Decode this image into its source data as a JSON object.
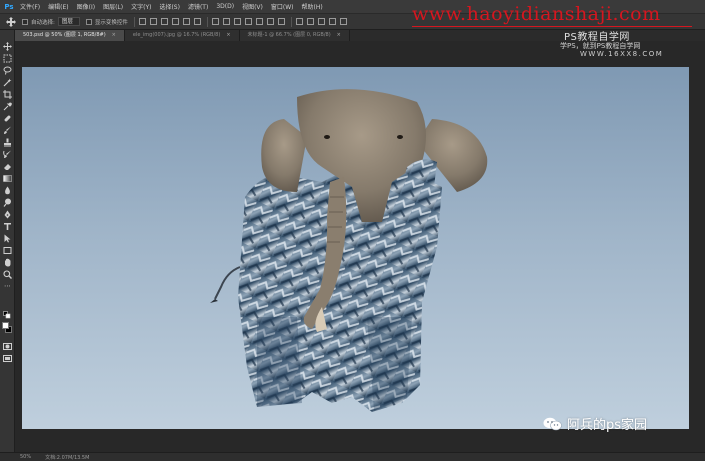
{
  "app": {
    "logo": "Ps"
  },
  "menu": [
    "文件(F)",
    "编辑(E)",
    "图像(I)",
    "图层(L)",
    "文字(Y)",
    "选择(S)",
    "滤镜(T)",
    "3D(D)",
    "视图(V)",
    "窗口(W)",
    "帮助(H)"
  ],
  "options": {
    "auto_select_label": "自动选择:",
    "auto_select_value": "图层",
    "show_transform_label": "显示变换控件"
  },
  "tabs": [
    {
      "label": "503.psd @ 50% (图层 1, RGB/8#)",
      "active": true
    },
    {
      "label": "ele_img(007).jpg @ 16.7% (RGB/8)",
      "active": false
    },
    {
      "label": "未标题-1 @ 66.7% (图层 0, RGB/8)",
      "active": false
    }
  ],
  "status": {
    "zoom": "50%",
    "doc": "文档:2.07M/13.5M"
  },
  "watermark": {
    "url": "www.haoyidianshaji.com",
    "title": "PS教程自学网",
    "subtitle": "学PS，就到PS教程自学网",
    "domain": "WWW.16XX8.COM",
    "wechat": "阿兵的ps家园"
  },
  "colors": {
    "accent": "#31a8ff",
    "watermark_red": "#d6161f",
    "fg_swatch": "#ffffff",
    "bg_swatch": "#000000"
  },
  "tools": [
    "move-icon",
    "marquee-icon",
    "lasso-icon",
    "magic-wand-icon",
    "crop-icon",
    "eyedropper-icon",
    "healing-icon",
    "brush-icon",
    "stamp-icon",
    "history-brush-icon",
    "eraser-icon",
    "gradient-icon",
    "blur-icon",
    "dodge-icon",
    "pen-icon",
    "type-icon",
    "path-select-icon",
    "shape-icon",
    "hand-icon",
    "zoom-icon"
  ]
}
